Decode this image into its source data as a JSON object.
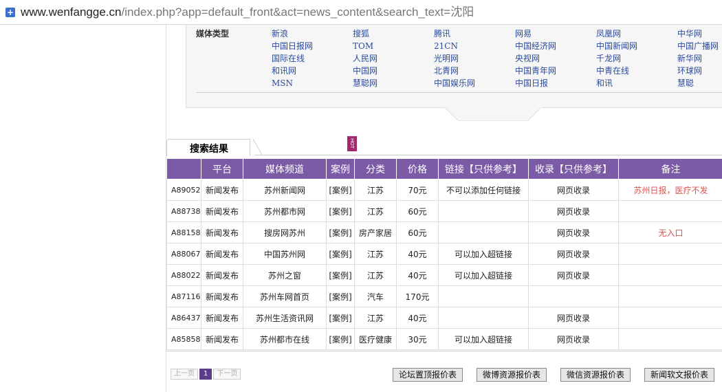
{
  "browser": {
    "url_domain": "www.wenfangge.cn",
    "url_path": "/index.php?app=default_front&act=news_content&search_text=沈阳"
  },
  "media_panel": {
    "label": "媒体类型",
    "links": [
      "新浪",
      "搜狐",
      "腾讯",
      "网易",
      "凤凰网",
      "中华网",
      "中国日报网",
      "TOM",
      "21CN",
      "中国经济网",
      "中国新闻网",
      "中国广播网",
      "国际在线",
      "人民网",
      "光明网",
      "央视网",
      "千龙网",
      "新华网",
      "和讯网",
      "中国网",
      "北青网",
      "中国青年网",
      "中青在线",
      "环球网",
      "MSN",
      "慧聪网",
      "中国娱乐网",
      "中国日报",
      "和讯",
      "慧聪"
    ]
  },
  "results": {
    "title": "搜索结果",
    "hot_badge": "HOT",
    "headers": [
      "",
      "平台",
      "媒体频道",
      "案例",
      "分类",
      "价格",
      "链接【只供参考】",
      "收录【只供参考】",
      "备注"
    ],
    "rows": [
      {
        "id": "A89052",
        "platform": "新闻发布",
        "channel": "苏州新闻网",
        "case": "[案例]",
        "category": "江苏",
        "price": "70元",
        "link": "不可以添加任何链接",
        "index": "网页收录",
        "note": "苏州日报，医疗不发"
      },
      {
        "id": "A88738",
        "platform": "新闻发布",
        "channel": "苏州都市网",
        "case": "[案例]",
        "category": "江苏",
        "price": "60元",
        "link": "",
        "index": "网页收录",
        "note": ""
      },
      {
        "id": "A88158",
        "platform": "新闻发布",
        "channel": "搜房网苏州",
        "case": "[案例]",
        "category": "房产家居",
        "price": "60元",
        "link": "",
        "index": "网页收录",
        "note": "无入口"
      },
      {
        "id": "A88067",
        "platform": "新闻发布",
        "channel": "中国苏州网",
        "case": "[案例]",
        "category": "江苏",
        "price": "40元",
        "link": "可以加入超链接",
        "index": "网页收录",
        "note": ""
      },
      {
        "id": "A88022",
        "platform": "新闻发布",
        "channel": "苏州之窗",
        "case": "[案例]",
        "category": "江苏",
        "price": "40元",
        "link": "可以加入超链接",
        "index": "网页收录",
        "note": ""
      },
      {
        "id": "A87116",
        "platform": "新闻发布",
        "channel": "苏州车网首页",
        "case": "[案例]",
        "category": "汽车",
        "price": "170元",
        "link": "",
        "index": "",
        "note": ""
      },
      {
        "id": "A86437",
        "platform": "新闻发布",
        "channel": "苏州生活资讯网",
        "case": "[案例]",
        "category": "江苏",
        "price": "40元",
        "link": "",
        "index": "网页收录",
        "note": ""
      },
      {
        "id": "A85858",
        "platform": "新闻发布",
        "channel": "苏州都市在线",
        "case": "[案例]",
        "category": "医疗健康",
        "price": "30元",
        "link": "可以加入超链接",
        "index": "网页收录",
        "note": ""
      }
    ]
  },
  "pager": {
    "prev": "上一页",
    "current": "1",
    "next": "下一页"
  },
  "buttons": {
    "forum": "论坛置顶报价表",
    "weibo": "微博资源报价表",
    "wechat": "微信资源报价表",
    "softnews": "新闻软文报价表"
  },
  "colors": {
    "header_bg": "#7b5aa6",
    "note_red": "#d9534f",
    "link_blue": "#2a4a9b",
    "hot_badge": "#a3276f"
  }
}
